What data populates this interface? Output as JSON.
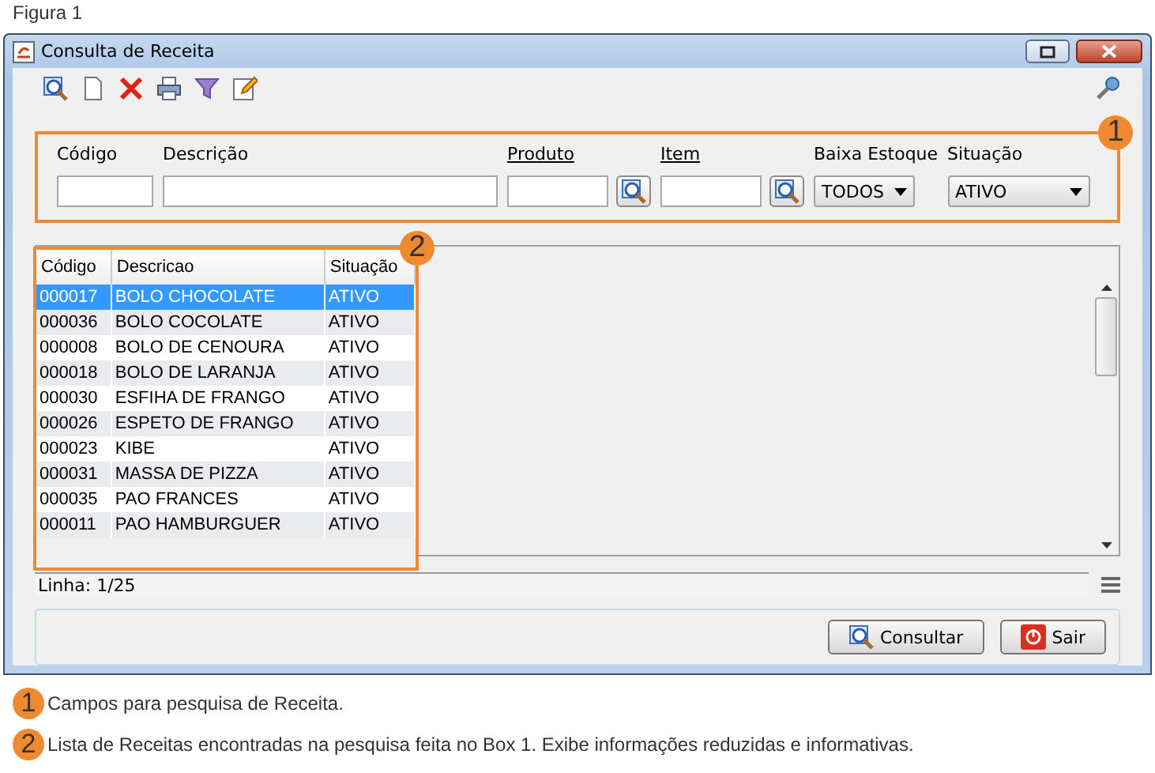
{
  "caption": "Figura 1",
  "window": {
    "title": "Consulta de Receita"
  },
  "toolbar": [
    {
      "kind": "search"
    },
    {
      "kind": "new"
    },
    {
      "kind": "delete"
    },
    {
      "kind": "print"
    },
    {
      "kind": "filter"
    },
    {
      "kind": "edit"
    }
  ],
  "filters": {
    "callout": "1",
    "fields": [
      {
        "kind": "text",
        "label": "Código",
        "underlined": false
      },
      {
        "kind": "text",
        "label": "Descrição",
        "underlined": false
      },
      {
        "kind": "lookup",
        "label": "Produto",
        "underlined": true
      },
      {
        "kind": "lookup",
        "label": "Item",
        "underlined": true
      },
      {
        "kind": "select",
        "label": "Baixa Estoque",
        "underlined": false,
        "value": "TODOS"
      },
      {
        "kind": "select",
        "label": "Situação",
        "underlined": false,
        "value": "ATIVO"
      }
    ]
  },
  "table": {
    "callout": "2",
    "columns": [
      "Código",
      "Descricao",
      "Situação"
    ],
    "rows": [
      {
        "cells": [
          "000017",
          "BOLO CHOCOLATE",
          "ATIVO"
        ],
        "selected": true
      },
      {
        "cells": [
          "000036",
          "BOLO COCOLATE",
          "ATIVO"
        ],
        "selected": false
      },
      {
        "cells": [
          "000008",
          "BOLO DE CENOURA",
          "ATIVO"
        ],
        "selected": false
      },
      {
        "cells": [
          "000018",
          "BOLO DE LARANJA",
          "ATIVO"
        ],
        "selected": false
      },
      {
        "cells": [
          "000030",
          "ESFIHA DE FRANGO",
          "ATIVO"
        ],
        "selected": false
      },
      {
        "cells": [
          "000026",
          "ESPETO DE FRANGO",
          "ATIVO"
        ],
        "selected": false
      },
      {
        "cells": [
          "000023",
          "KIBE",
          "ATIVO"
        ],
        "selected": false
      },
      {
        "cells": [
          "000031",
          "MASSA DE PIZZA",
          "ATIVO"
        ],
        "selected": false
      },
      {
        "cells": [
          "000035",
          "PAO FRANCES",
          "ATIVO"
        ],
        "selected": false
      },
      {
        "cells": [
          "000011",
          "PAO HAMBURGUER",
          "ATIVO"
        ],
        "selected": false
      }
    ]
  },
  "status_bar": "Linha: 1/25",
  "buttons": [
    {
      "kind": "search",
      "label": "Consultar"
    },
    {
      "kind": "exit",
      "label": "Sair"
    }
  ],
  "notes": [
    {
      "number": "1",
      "text": "Campos para pesquisa de Receita."
    },
    {
      "number": "2",
      "text": "Lista de Receitas encontradas na pesquisa feita no Box 1. Exibe informações reduzidas e informativas."
    }
  ]
}
